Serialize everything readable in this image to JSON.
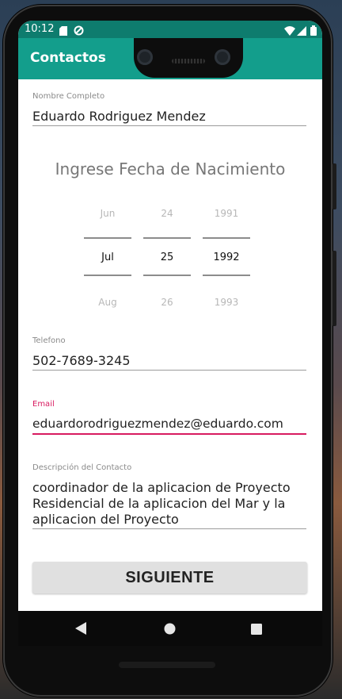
{
  "status_bar": {
    "time": "10:12",
    "icons": [
      "sd-card-icon",
      "sync-icon",
      "wifi-icon",
      "cell-signal-icon",
      "battery-icon"
    ]
  },
  "app_bar": {
    "title": "Contactos"
  },
  "form": {
    "name": {
      "label": "Nombre Completo",
      "value": "Eduardo Rodriguez Mendez"
    },
    "birthdate_heading": "Ingrese Fecha de Nacimiento",
    "date_picker": {
      "month": {
        "prev": "Jun",
        "selected": "Jul",
        "next": "Aug"
      },
      "day": {
        "prev": "24",
        "selected": "25",
        "next": "26"
      },
      "year": {
        "prev": "1991",
        "selected": "1992",
        "next": "1993"
      }
    },
    "phone": {
      "label": "Telefono",
      "value": "502-7689-3245"
    },
    "email": {
      "label": "Email",
      "value": "eduardorodriguezmendez@eduardo.com"
    },
    "description": {
      "label": "Descripción del Contacto",
      "line1": "coordinador de la aplicacion de Proyecto",
      "line2": "Residencial de la aplicacion del Mar y la",
      "line3": "aplicacion del Proyecto"
    },
    "next_button": "SIGUIENTE"
  },
  "colors": {
    "status_bar": "#0e7c6e",
    "app_bar": "#139e8c",
    "focused_accent": "#d81b60",
    "button_bg": "#e0e0e0"
  },
  "nav_bar": {
    "icons": [
      "back-icon",
      "home-icon",
      "recents-icon"
    ]
  }
}
